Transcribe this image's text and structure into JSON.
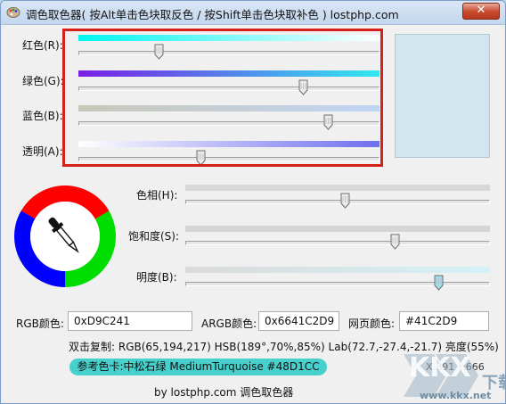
{
  "window": {
    "title": "调色取色器( 按Alt单击色块取反色 / 按Shift单击色块取补色 ) lostphp.com",
    "close_glyph": "✕"
  },
  "sliders_top": [
    {
      "label": "红色(R):",
      "value": 65,
      "max": 255,
      "gradient": [
        "#00f5f0",
        "#ffffff"
      ]
    },
    {
      "label": "绿色(G):",
      "value": 194,
      "max": 255,
      "gradient": [
        "#7a1fe6",
        "#30e8f0"
      ]
    },
    {
      "label": "蓝色(B):",
      "value": 217,
      "max": 255,
      "gradient": [
        "#c8c8b8",
        "#c0d4f4"
      ]
    },
    {
      "label": "透明(A):",
      "value": 102,
      "max": 255,
      "gradient": [
        "#ffffff",
        "#6f6ff0"
      ]
    }
  ],
  "sliders_hsb": [
    {
      "label": "色相(H):",
      "value": 189,
      "max": 360,
      "gradient": [
        "#d8d8d8",
        "#d8d8d8"
      ]
    },
    {
      "label": "饱和度(S):",
      "value": 70,
      "max": 100,
      "gradient": [
        "#d4d6d6",
        "#d4d6d6"
      ]
    },
    {
      "label": "明度(B):",
      "value": 85,
      "max": 100,
      "gradient": [
        "#dadada",
        "#d4f2f8"
      ]
    }
  ],
  "preview_color": "#D1E6EE",
  "fields": {
    "rgb_label": "RGB颜色:",
    "rgb_value": "0xD9C241",
    "argb_label": "ARGB颜色:",
    "argb_value": "0x6641C2D9",
    "web_label": "网页颜色:",
    "web_value": "#41C2D9"
  },
  "info": {
    "copy_line": "双击复制: RGB(65,194,217) HSB(189°,70%,85%) Lab(72.7,-27.4,-21.7) 亮度(55%)",
    "ref_color": "参考色卡:中松石绿 MediumTurquoise #48D1CC",
    "ref_bg": "#48D1CC",
    "coords": "X:891 Y:666"
  },
  "footer": "by lostphp.com 调色取色器",
  "watermark": {
    "brand": "KKX",
    "sub": "下载",
    "url": "www.kkx.net"
  },
  "colors": {
    "highlight_border": "#d6201a",
    "wheel": [
      "#ff0000",
      "#00dd00",
      "#0000ff"
    ]
  }
}
